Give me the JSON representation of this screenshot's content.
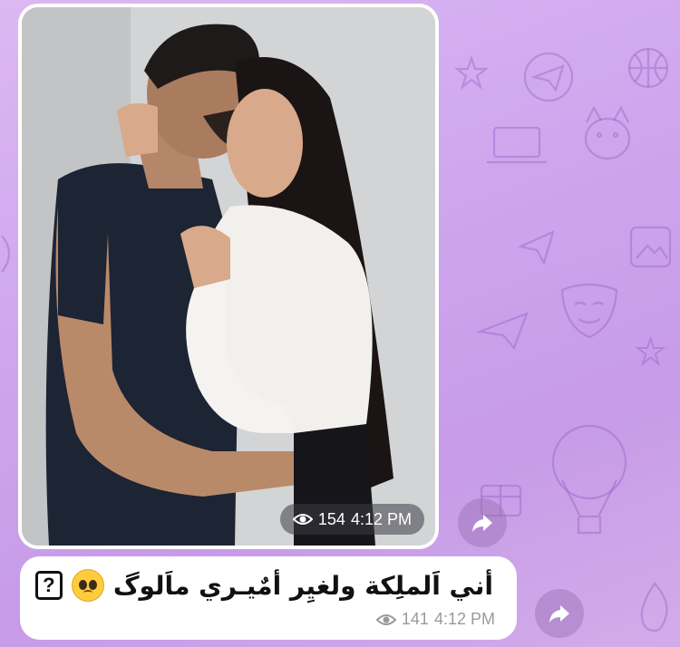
{
  "photo_message": {
    "views": "154",
    "time": "4:12 PM",
    "image_description_icon": "photo-couple"
  },
  "text_message": {
    "text": "أني اَلملِكة ولغيِر أمٌيـري ماَلوگ",
    "views": "141",
    "time": "4:12 PM",
    "emoji": "pleading-face",
    "box_glyph": "?"
  },
  "colors": {
    "background": "#cfa8ee",
    "bubble": "#ffffff",
    "meta_text": "#9a9a9a",
    "pill_bg": "rgba(60,60,70,0.55)"
  },
  "icons": {
    "eye": "eye-icon",
    "forward": "forward-arrow-icon"
  }
}
